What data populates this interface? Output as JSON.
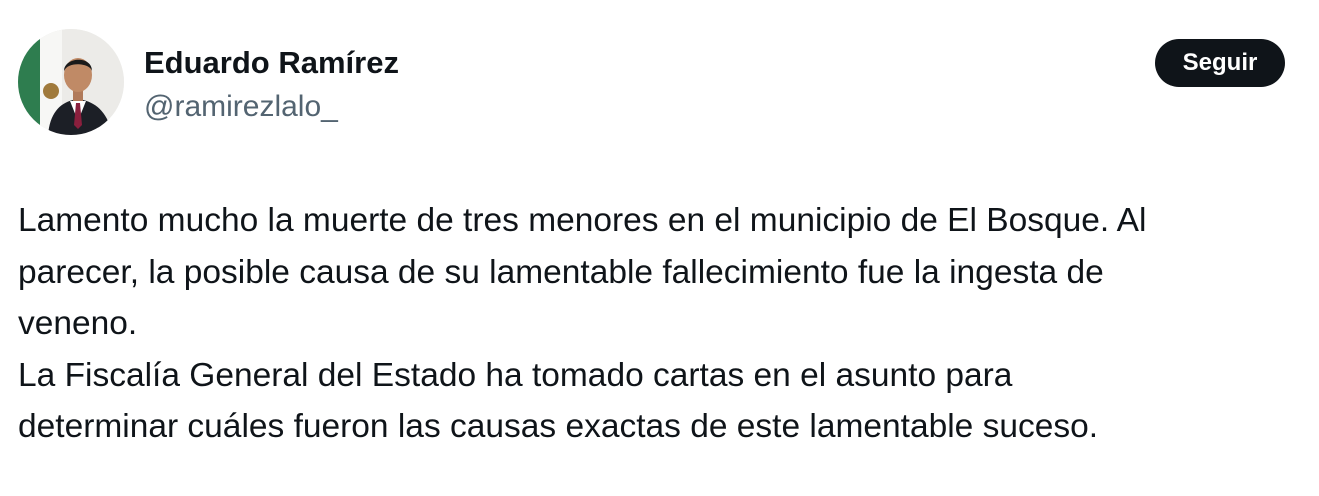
{
  "author": {
    "display_name": "Eduardo Ramírez",
    "handle": "@ramirezlalo_",
    "avatar_icon": "profile-photo"
  },
  "actions": {
    "follow_label": "Seguir"
  },
  "tweet": {
    "lines": [
      "Lamento mucho la muerte de tres menores en el municipio de El Bosque. Al",
      "parecer, la posible causa de su lamentable fallecimiento fue la ingesta de",
      "veneno.",
      "La Fiscalía General del Estado ha tomado cartas en el asunto para",
      "determinar cuáles fueron las causas exactas de este lamentable suceso."
    ]
  },
  "colors": {
    "text_primary": "#0f1419",
    "text_secondary": "#536471",
    "button_bg": "#0f1419",
    "button_text": "#ffffff",
    "background": "#ffffff"
  }
}
